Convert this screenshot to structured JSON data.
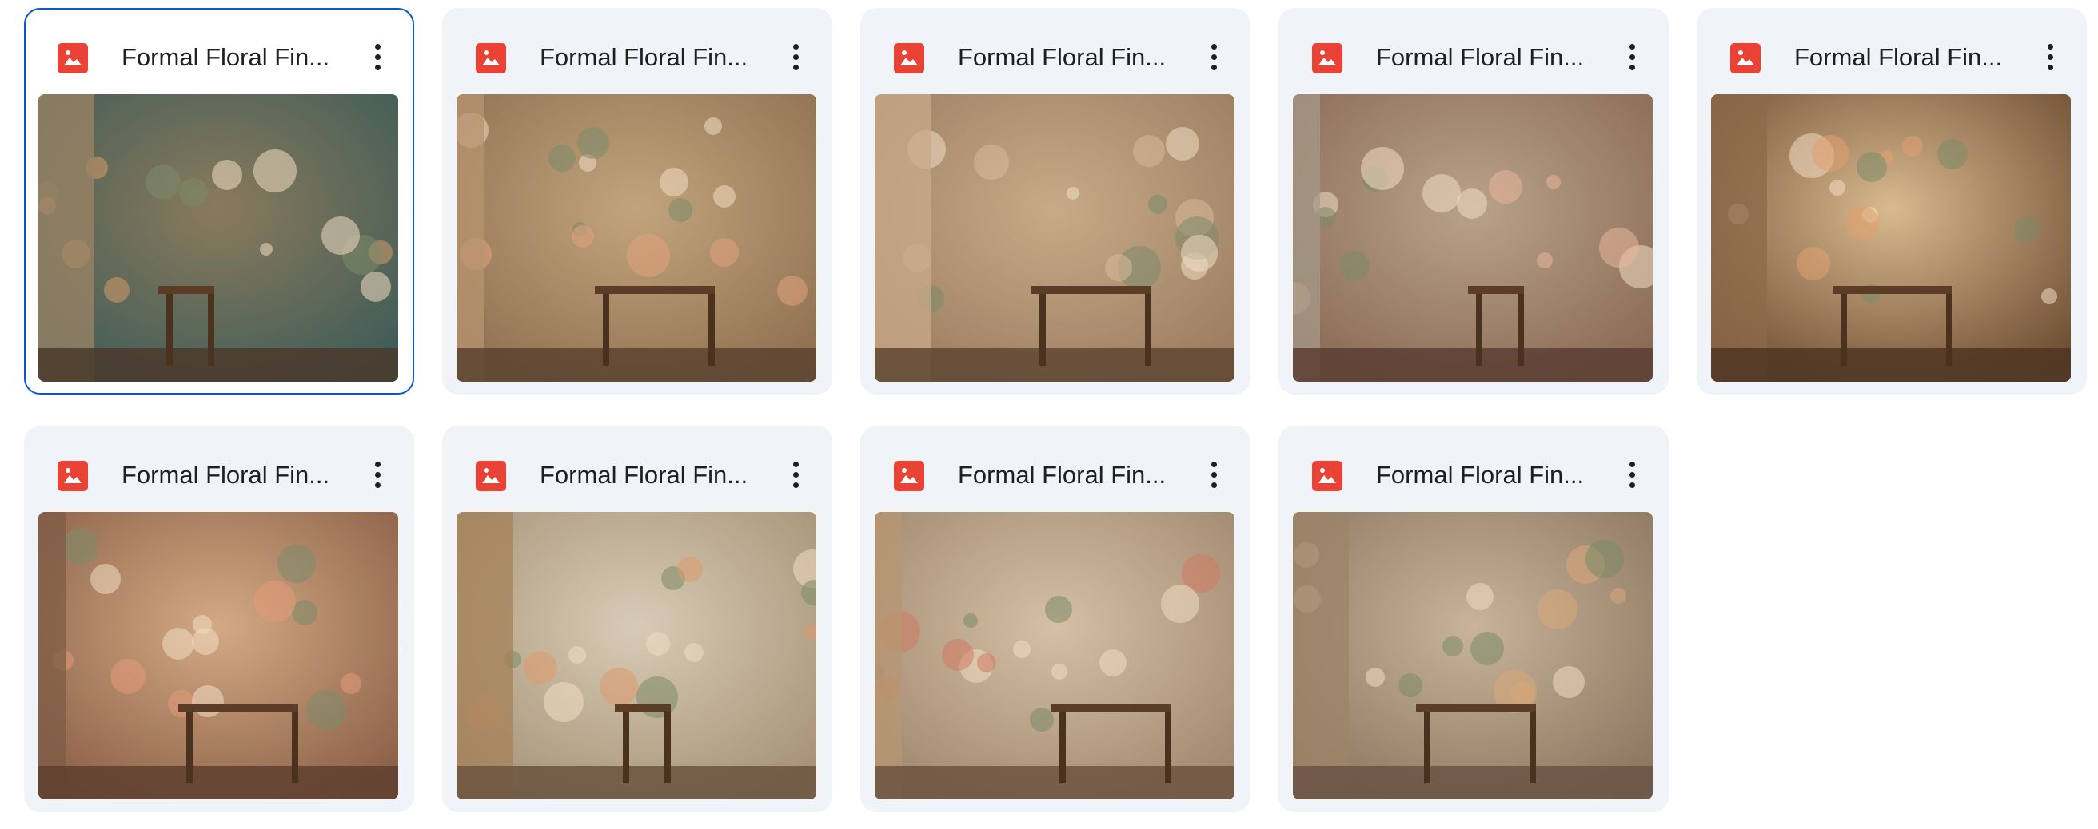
{
  "files": [
    {
      "name": "Formal Floral Fin...",
      "type": "image",
      "selected": true,
      "palette": {
        "bg1": "#3f5c57",
        "bg2": "#8a7a5c",
        "floor": "#4a3a2c",
        "accent": "#d49a6a",
        "curtain": "#9c8466"
      }
    },
    {
      "name": "Formal Floral Fin...",
      "type": "image",
      "selected": false,
      "palette": {
        "bg1": "#8f7152",
        "bg2": "#c2a47c",
        "floor": "#5a4330",
        "accent": "#e2a27e",
        "curtain": "#b89470"
      }
    },
    {
      "name": "Formal Floral Fin...",
      "type": "image",
      "selected": false,
      "palette": {
        "bg1": "#9a7d60",
        "bg2": "#c7ab88",
        "floor": "#5e4634",
        "accent": "#d8b99a",
        "curtain": "#c9a98a"
      }
    },
    {
      "name": "Formal Floral Fin...",
      "type": "image",
      "selected": false,
      "palette": {
        "bg1": "#8a6a55",
        "bg2": "#b9a28a",
        "floor": "#5a3e33",
        "accent": "#e8b49a",
        "curtain": "#a79a88"
      }
    },
    {
      "name": "Formal Floral Fin...",
      "type": "image",
      "selected": false,
      "palette": {
        "bg1": "#6e4d33",
        "bg2": "#d9b98e",
        "floor": "#4e3624",
        "accent": "#e0a070",
        "curtain": "#8c6a4a"
      }
    },
    {
      "name": "Formal Floral Fin...",
      "type": "image",
      "selected": false,
      "palette": {
        "bg1": "#8b6048",
        "bg2": "#d3aa84",
        "floor": "#5e4030",
        "accent": "#e49a78",
        "curtain": "#7e5c44"
      }
    },
    {
      "name": "Formal Floral Fin...",
      "type": "image",
      "selected": false,
      "palette": {
        "bg1": "#a69276",
        "bg2": "#d8cbb6",
        "floor": "#6a5440",
        "accent": "#dd9a6c",
        "curtain": "#a5825a"
      }
    },
    {
      "name": "Formal Floral Fin...",
      "type": "image",
      "selected": false,
      "palette": {
        "bg1": "#a08870",
        "bg2": "#d5c0a4",
        "floor": "#6c5440",
        "accent": "#cf7a62",
        "curtain": "#b79772"
      }
    },
    {
      "name": "Formal Floral Fin...",
      "type": "image",
      "selected": false,
      "palette": {
        "bg1": "#8c7660",
        "bg2": "#c8b49a",
        "floor": "#6a5444",
        "accent": "#d8a878",
        "curtain": "#9d8468"
      }
    }
  ],
  "icons": {
    "file_type": "image-file-icon",
    "menu": "more-vert-icon"
  },
  "colors": {
    "selection_border": "#0b57d0",
    "card_bg": "#f0f4f9",
    "icon_red": "#ea4335"
  }
}
